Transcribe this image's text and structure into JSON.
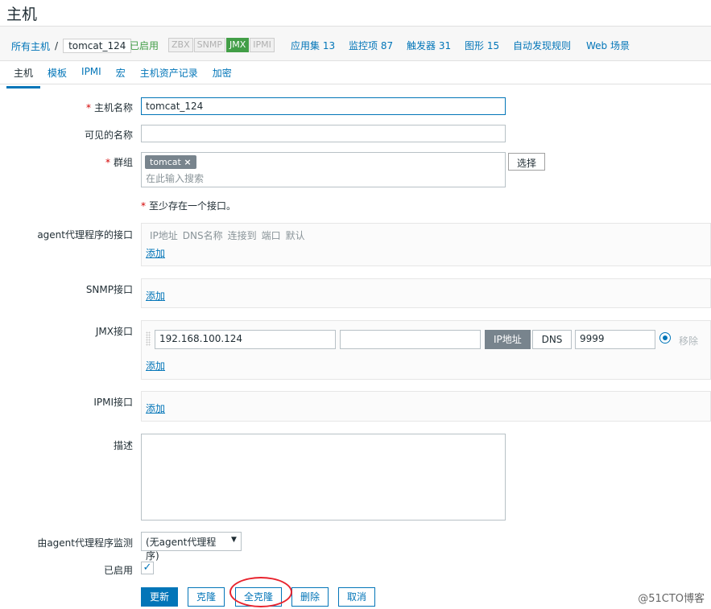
{
  "page_title": "主机",
  "breadcrumb": {
    "all_hosts": "所有主机",
    "sep": "/",
    "current": "tomcat_124"
  },
  "status": "已启用",
  "availability": {
    "zbx": "ZBX",
    "snmp": "SNMP",
    "jmx": "JMX",
    "ipmi": "IPMI"
  },
  "header_links": {
    "applications": "应用集 13",
    "items": "监控项 87",
    "triggers": "触发器 31",
    "graphs": "图形 15",
    "discovery": "自动发现规则",
    "web": "Web 场景"
  },
  "tabs": [
    "主机",
    "模板",
    "IPMI",
    "宏",
    "主机资产记录",
    "加密"
  ],
  "form": {
    "host_name_label": "主机名称",
    "host_name_value": "tomcat_124",
    "visible_name_label": "可见的名称",
    "visible_name_value": "",
    "groups_label": "群组",
    "group_tag": "tomcat",
    "group_search_placeholder": "在此输入搜索",
    "select_button": "选择",
    "interface_note": "至少存在一个接口。",
    "agent_label": "agent代理程序的接口",
    "agent_cols": [
      "IP地址",
      "DNS名称",
      "连接到",
      "端口",
      "默认"
    ],
    "add_link": "添加",
    "snmp_label": "SNMP接口",
    "jmx_label": "JMX接口",
    "jmx_ip": "192.168.100.124",
    "jmx_dns": "",
    "jmx_connect_ip": "IP地址",
    "jmx_connect_dns": "DNS",
    "jmx_port": "9999",
    "remove_link": "移除",
    "ipmi_label": "IPMI接口",
    "description_label": "描述",
    "description_value": "",
    "proxy_label": "由agent代理程序监测",
    "proxy_value": "(无agent代理程序)",
    "enabled_label": "已启用",
    "enabled_check": "✓"
  },
  "buttons": {
    "update": "更新",
    "clone": "克隆",
    "full_clone": "全克隆",
    "delete": "删除",
    "cancel": "取消"
  },
  "watermark": "@51CTO博客",
  "colors": {
    "link": "#0275b8",
    "enabled": "#429e47",
    "required": "#d40000",
    "annotation_circle": "#e8232d"
  }
}
